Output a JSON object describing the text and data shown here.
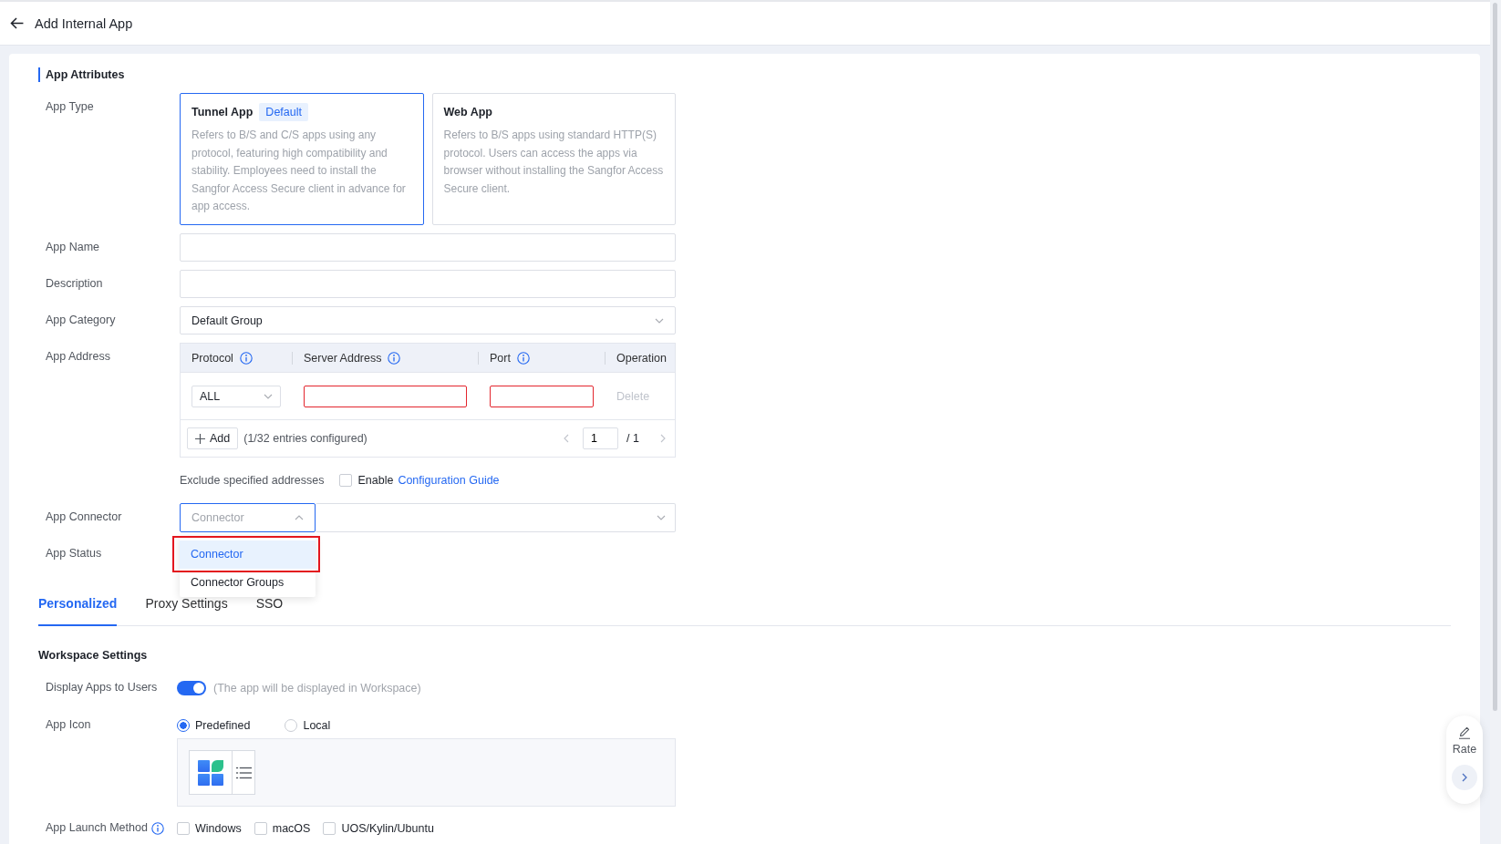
{
  "header": {
    "title": "Add Internal App"
  },
  "section": {
    "title": "App Attributes"
  },
  "form": {
    "app_type": {
      "label": "App Type",
      "options": [
        {
          "title": "Tunnel App",
          "badge": "Default",
          "description": "Refers to B/S and C/S apps using any protocol, featuring high compatibility and stability. Employees need to install the Sangfor Access Secure client in advance for app access.",
          "selected": true
        },
        {
          "title": "Web App",
          "description": "Refers to B/S apps using standard HTTP(S) protocol. Users can access the apps via browser without installing the Sangfor Access Secure client.",
          "selected": false
        }
      ]
    },
    "app_name": {
      "label": "App Name"
    },
    "description": {
      "label": "Description"
    },
    "app_category": {
      "label": "App Category",
      "value": "Default Group"
    },
    "app_address": {
      "label": "App Address",
      "columns": [
        {
          "label": "Protocol",
          "info": true
        },
        {
          "label": "Server Address",
          "info": true
        },
        {
          "label": "Port",
          "info": true
        },
        {
          "label": "Operation",
          "info": false
        }
      ],
      "rows": [
        {
          "protocol": "ALL",
          "server_address": {
            "invalid": true
          },
          "port": {
            "invalid": true
          },
          "delete": {
            "label": "Delete",
            "disabled": true
          }
        }
      ],
      "add_button": "Add",
      "entries_note": "(1/32 entries configured)",
      "pagination": {
        "page": "1",
        "total": "/ 1"
      }
    },
    "exclude": {
      "label": "Exclude specified addresses",
      "checked": false,
      "checkbox_label": "Enable",
      "link": "Configuration Guide"
    },
    "app_connector": {
      "label": "App Connector",
      "type_select": {
        "placeholder": "Connector",
        "expanded": true
      },
      "options": [
        {
          "label": "Connector",
          "selected": true,
          "highlighted": true
        },
        {
          "label": "Connector Groups",
          "selected": false,
          "highlighted": false
        }
      ]
    },
    "app_status": {
      "label": "App Status"
    }
  },
  "tabs": [
    {
      "label": "Personalized",
      "selected": true
    },
    {
      "label": "Proxy Settings",
      "selected": false
    },
    {
      "label": "SSO",
      "selected": false
    }
  ],
  "workspace": {
    "title": "Workspace Settings",
    "display_apps": {
      "label": "Display Apps to Users",
      "on": true,
      "hint": "(The app will be displayed in Workspace)"
    },
    "app_icon": {
      "label": "App Icon",
      "options": [
        {
          "label": "Predefined",
          "selected": true
        },
        {
          "label": "Local",
          "selected": false
        }
      ]
    },
    "launch_method": {
      "label": "App Launch Method",
      "info": true,
      "options": [
        {
          "label": "Windows",
          "checked": false
        },
        {
          "label": "macOS",
          "checked": false
        },
        {
          "label": "UOS/Kylin/Ubuntu",
          "checked": false
        }
      ]
    }
  },
  "rate_panel": {
    "label": "Rate"
  }
}
